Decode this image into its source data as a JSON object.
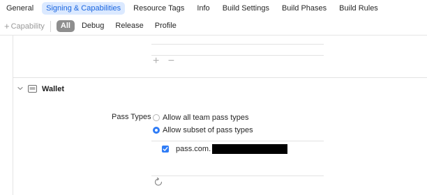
{
  "tabs": [
    {
      "label": "General"
    },
    {
      "label": "Signing & Capabilities",
      "active": true
    },
    {
      "label": "Resource Tags"
    },
    {
      "label": "Info"
    },
    {
      "label": "Build Settings"
    },
    {
      "label": "Build Phases"
    },
    {
      "label": "Build Rules"
    }
  ],
  "filterbar": {
    "capability_label": "Capability",
    "capability_icon": "plus-icon",
    "configs": [
      {
        "label": "All",
        "active": true
      },
      {
        "label": "Debug"
      },
      {
        "label": "Release"
      },
      {
        "label": "Profile"
      }
    ]
  },
  "list_controls": {
    "add": "+",
    "remove": "−"
  },
  "wallet": {
    "title": "Wallet",
    "icon": "wallet-icon",
    "pass_types_label": "Pass Types",
    "options": [
      {
        "label": "Allow all team pass types",
        "selected": false
      },
      {
        "label": "Allow subset of pass types",
        "selected": true
      }
    ],
    "passes": [
      {
        "prefix": "pass.com.",
        "checked": true
      }
    ]
  },
  "colors": {
    "accent": "#2f7cf6",
    "tab_active_bg": "#dbe9ff",
    "tab_active_text": "#1a66e0"
  }
}
